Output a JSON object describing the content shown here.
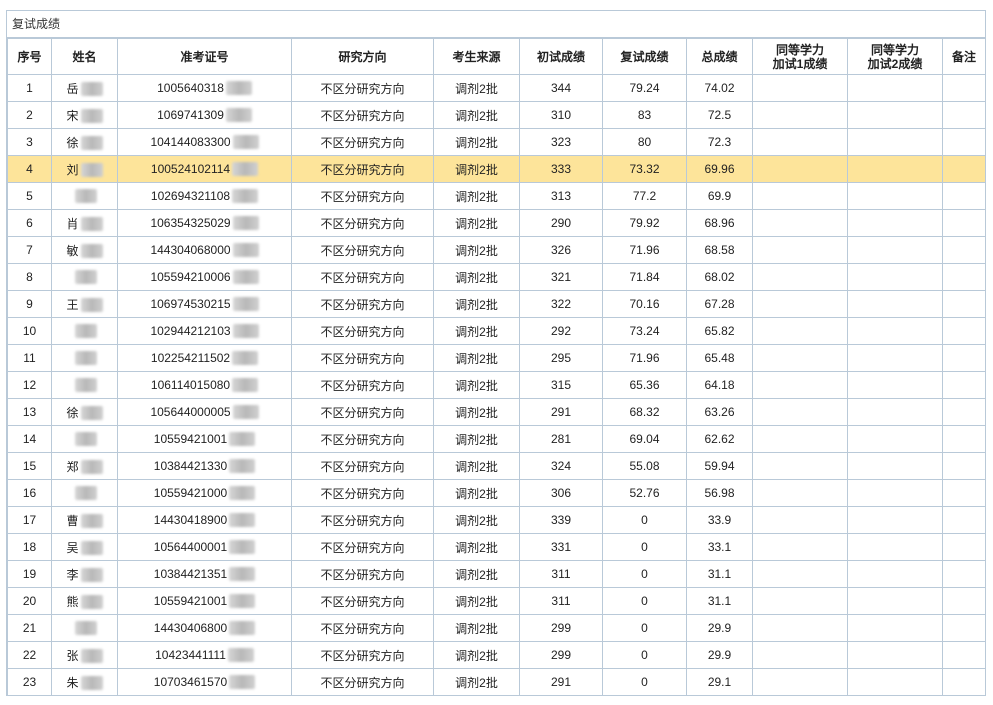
{
  "panel": {
    "title": "复试成绩"
  },
  "columns": [
    "序号",
    "姓名",
    "准考证号",
    "研究方向",
    "考生来源",
    "初试成绩",
    "复试成绩",
    "总成绩",
    "同等学力\n加试1成绩",
    "同等学力\n加试2成绩",
    "备注"
  ],
  "rows": [
    {
      "no": "1",
      "name": "岳",
      "id": "1005640318",
      "dir": "不区分研究方向",
      "src": "调剂2批",
      "s1": "344",
      "s2": "79.24",
      "total": "74.02",
      "e1": "",
      "e2": "",
      "note": ""
    },
    {
      "no": "2",
      "name": "宋",
      "id": "1069741309",
      "dir": "不区分研究方向",
      "src": "调剂2批",
      "s1": "310",
      "s2": "83",
      "total": "72.5",
      "e1": "",
      "e2": "",
      "note": ""
    },
    {
      "no": "3",
      "name": "徐",
      "id": "104144083300",
      "dir": "不区分研究方向",
      "src": "调剂2批",
      "s1": "323",
      "s2": "80",
      "total": "72.3",
      "e1": "",
      "e2": "",
      "note": ""
    },
    {
      "no": "4",
      "name": "刘",
      "id": "100524102114",
      "dir": "不区分研究方向",
      "src": "调剂2批",
      "s1": "333",
      "s2": "73.32",
      "total": "69.96",
      "e1": "",
      "e2": "",
      "note": ""
    },
    {
      "no": "5",
      "name": "",
      "id": "102694321108",
      "dir": "不区分研究方向",
      "src": "调剂2批",
      "s1": "313",
      "s2": "77.2",
      "total": "69.9",
      "e1": "",
      "e2": "",
      "note": ""
    },
    {
      "no": "6",
      "name": "肖",
      "id": "106354325029",
      "dir": "不区分研究方向",
      "src": "调剂2批",
      "s1": "290",
      "s2": "79.92",
      "total": "68.96",
      "e1": "",
      "e2": "",
      "note": ""
    },
    {
      "no": "7",
      "name": "敏",
      "id": "144304068000",
      "dir": "不区分研究方向",
      "src": "调剂2批",
      "s1": "326",
      "s2": "71.96",
      "total": "68.58",
      "e1": "",
      "e2": "",
      "note": ""
    },
    {
      "no": "8",
      "name": "",
      "id": "105594210006",
      "dir": "不区分研究方向",
      "src": "调剂2批",
      "s1": "321",
      "s2": "71.84",
      "total": "68.02",
      "e1": "",
      "e2": "",
      "note": ""
    },
    {
      "no": "9",
      "name": "王",
      "id": "106974530215",
      "dir": "不区分研究方向",
      "src": "调剂2批",
      "s1": "322",
      "s2": "70.16",
      "total": "67.28",
      "e1": "",
      "e2": "",
      "note": ""
    },
    {
      "no": "10",
      "name": "",
      "id": "102944212103",
      "dir": "不区分研究方向",
      "src": "调剂2批",
      "s1": "292",
      "s2": "73.24",
      "total": "65.82",
      "e1": "",
      "e2": "",
      "note": ""
    },
    {
      "no": "11",
      "name": "",
      "id": "102254211502",
      "dir": "不区分研究方向",
      "src": "调剂2批",
      "s1": "295",
      "s2": "71.96",
      "total": "65.48",
      "e1": "",
      "e2": "",
      "note": ""
    },
    {
      "no": "12",
      "name": "",
      "id": "106114015080",
      "dir": "不区分研究方向",
      "src": "调剂2批",
      "s1": "315",
      "s2": "65.36",
      "total": "64.18",
      "e1": "",
      "e2": "",
      "note": ""
    },
    {
      "no": "13",
      "name": "徐",
      "id": "105644000005",
      "dir": "不区分研究方向",
      "src": "调剂2批",
      "s1": "291",
      "s2": "68.32",
      "total": "63.26",
      "e1": "",
      "e2": "",
      "note": ""
    },
    {
      "no": "14",
      "name": "",
      "id": "10559421001",
      "dir": "不区分研究方向",
      "src": "调剂2批",
      "s1": "281",
      "s2": "69.04",
      "total": "62.62",
      "e1": "",
      "e2": "",
      "note": ""
    },
    {
      "no": "15",
      "name": "郑",
      "id": "10384421330",
      "dir": "不区分研究方向",
      "src": "调剂2批",
      "s1": "324",
      "s2": "55.08",
      "total": "59.94",
      "e1": "",
      "e2": "",
      "note": ""
    },
    {
      "no": "16",
      "name": "",
      "id": "10559421000",
      "dir": "不区分研究方向",
      "src": "调剂2批",
      "s1": "306",
      "s2": "52.76",
      "total": "56.98",
      "e1": "",
      "e2": "",
      "note": ""
    },
    {
      "no": "17",
      "name": "曹",
      "id": "14430418900",
      "dir": "不区分研究方向",
      "src": "调剂2批",
      "s1": "339",
      "s2": "0",
      "total": "33.9",
      "e1": "",
      "e2": "",
      "note": ""
    },
    {
      "no": "18",
      "name": "吴",
      "id": "10564400001",
      "dir": "不区分研究方向",
      "src": "调剂2批",
      "s1": "331",
      "s2": "0",
      "total": "33.1",
      "e1": "",
      "e2": "",
      "note": ""
    },
    {
      "no": "19",
      "name": "李",
      "id": "10384421351",
      "dir": "不区分研究方向",
      "src": "调剂2批",
      "s1": "311",
      "s2": "0",
      "total": "31.1",
      "e1": "",
      "e2": "",
      "note": ""
    },
    {
      "no": "20",
      "name": "熊",
      "id": "10559421001",
      "dir": "不区分研究方向",
      "src": "调剂2批",
      "s1": "311",
      "s2": "0",
      "total": "31.1",
      "e1": "",
      "e2": "",
      "note": ""
    },
    {
      "no": "21",
      "name": "",
      "id": "14430406800",
      "dir": "不区分研究方向",
      "src": "调剂2批",
      "s1": "299",
      "s2": "0",
      "total": "29.9",
      "e1": "",
      "e2": "",
      "note": ""
    },
    {
      "no": "22",
      "name": "张",
      "id": "10423441111",
      "dir": "不区分研究方向",
      "src": "调剂2批",
      "s1": "299",
      "s2": "0",
      "total": "29.9",
      "e1": "",
      "e2": "",
      "note": ""
    },
    {
      "no": "23",
      "name": "朱",
      "id": "10703461570",
      "dir": "不区分研究方向",
      "src": "调剂2批",
      "s1": "291",
      "s2": "0",
      "total": "29.1",
      "e1": "",
      "e2": "",
      "note": ""
    }
  ],
  "highlight_row": "4",
  "colors": {
    "border": "#b9c9d8",
    "highlight": "#fde49a"
  }
}
